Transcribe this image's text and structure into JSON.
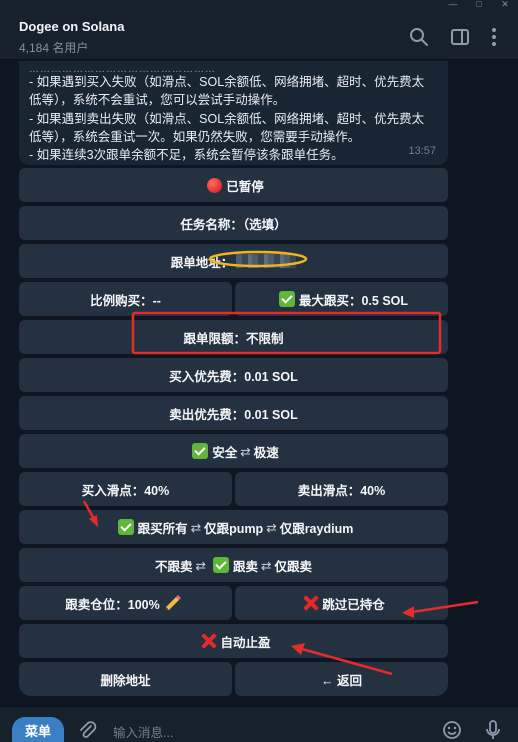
{
  "header": {
    "title": "Dogee on Solana",
    "subtitle": "4,184 名用户"
  },
  "message": {
    "cut_text": "……………………………………………",
    "lines": [
      "- 如果遇到买入失败（如滑点、SOL余额低、网络拥堵、超时、优先费太",
      "低等），系统不会重试，您可以尝试手动操作。",
      "- 如果遇到卖出失败（如滑点、SOL余额低、网络拥堵、超时、优先费太",
      "低等），系统会重试一次。如果仍然失败，您需要手动操作。",
      "- 如果连续3次跟单余额不足，系统会暂停该条跟单任务。"
    ],
    "time": "13:57"
  },
  "buttons": {
    "paused": "已暂停",
    "task_name": "任务名称：（选填）",
    "follow_address": "跟单地址：",
    "ratio_buy": "比例购买：--",
    "max_buy": "最大跟买：0.5 SOL",
    "follow_limit": "跟单限额：不限制",
    "buy_priority": "买入优先费：0.01 SOL",
    "sell_priority": "卖出优先费：0.01 SOL",
    "mode_safe": "安全",
    "mode_fast": "极速",
    "buy_slippage": "买入滑点：40%",
    "sell_slippage": "卖出滑点：40%",
    "follow_all": "跟买所有",
    "only_pump": "仅跟pump",
    "only_raydium": "仅跟raydium",
    "no_follow_sell": "不跟卖",
    "follow_sell": "跟卖",
    "only_follow_sell": "仅跟卖",
    "sell_position": "跟卖仓位：100%",
    "skip_held": "跳过已持仓",
    "auto_take_profit": "自动止盈",
    "delete_address": "删除地址",
    "back": "← 返回",
    "swap_symbol": "⇄"
  },
  "input": {
    "menu_label": "菜单",
    "placeholder": "输入消息..."
  },
  "icons": [
    "search-icon",
    "sidebar-icon",
    "more-icon",
    "paperclip-icon",
    "emoji-icon",
    "microphone-icon",
    "check-emoji",
    "red-circle-emoji",
    "cross-emoji",
    "pencil-emoji"
  ],
  "colors": {
    "background": "#0e1621",
    "header": "#17212b",
    "bubble": "#182533",
    "button": "#243141",
    "accent": "#3a7fc4",
    "annotation_red": "#e52b2b",
    "annotation_yellow": "#f0b41c"
  }
}
